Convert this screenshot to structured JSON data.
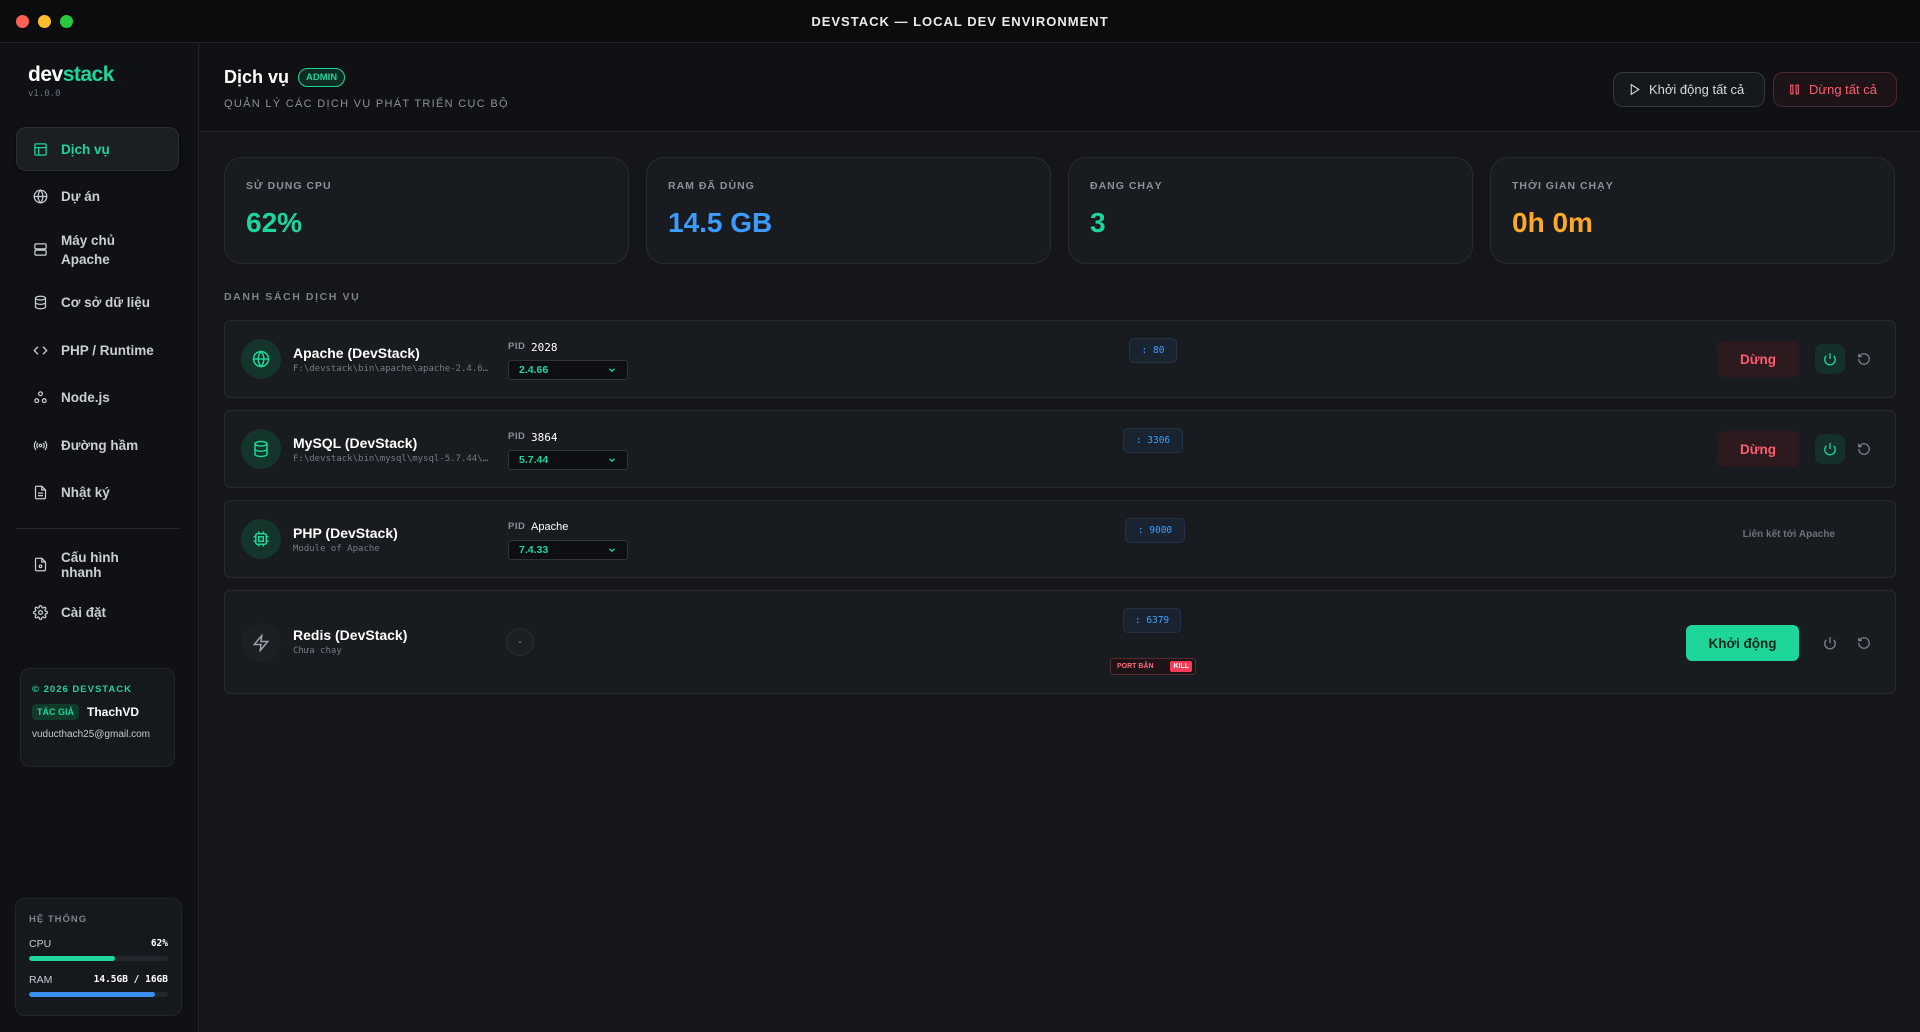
{
  "window": {
    "title": "DEVSTACK — LOCAL DEV ENVIRONMENT"
  },
  "brand": {
    "name_part1": "dev",
    "name_part2": "stack",
    "version": "v1.0.0"
  },
  "sidebar": {
    "items": [
      {
        "label": "Dịch vụ",
        "icon": "layout-icon"
      },
      {
        "label": "Dự án",
        "icon": "globe-icon"
      },
      {
        "label": "Máy chủ Apache",
        "icon": "server-icon"
      },
      {
        "label": "Cơ sở dữ liệu",
        "icon": "database-icon"
      },
      {
        "label": "PHP / Runtime",
        "icon": "code-icon"
      },
      {
        "label": "Node.js",
        "icon": "nodes-icon"
      },
      {
        "label": "Đường hầm",
        "icon": "broadcast-icon"
      },
      {
        "label": "Nhật ký",
        "icon": "file-text-icon"
      }
    ],
    "extra_items": [
      {
        "label": "Cấu hình nhanh",
        "icon": "file-config-icon"
      },
      {
        "label": "Cài đặt",
        "icon": "gear-icon"
      }
    ],
    "credit": {
      "copyright": "© 2026 DEVSTACK",
      "tag": "TÁC GIẢ",
      "author": "ThachVD",
      "email": "vuducthach25@gmail.com"
    },
    "system": {
      "heading": "HỆ THỐNG",
      "cpu_label": "CPU",
      "cpu_value": "62%",
      "cpu_fraction": 0.62,
      "ram_label": "RAM",
      "ram_value": "14.5GB / 16GB",
      "ram_fraction": 0.906
    }
  },
  "header": {
    "title": "Dịch vụ",
    "badge": "ADMIN",
    "subtitle": "QUẢN LÝ CÁC DỊCH VỤ PHÁT TRIỂN CỤC BỘ",
    "start_all": "Khởi động tất cả",
    "stop_all": "Dừng tất cả"
  },
  "stats": [
    {
      "label": "SỬ DỤNG CPU",
      "value": "62%",
      "color": "#1ed59a"
    },
    {
      "label": "RAM ĐÃ DÙNG",
      "value": "14.5 GB",
      "color": "#3b9bff"
    },
    {
      "label": "ĐANG CHẠY",
      "value": "3",
      "color": "#1ed59a"
    },
    {
      "label": "THỜI GIAN CHẠY",
      "value": "0h 0m",
      "color": "#ffa726"
    }
  ],
  "services_heading": "DANH SÁCH DỊCH VỤ",
  "services": [
    {
      "name": "Apache (DevStack)",
      "path": "F:\\devstack\\bin\\apache\\apache-2.4.6…",
      "pid_label": "PID",
      "pid": "2028",
      "version": "2.4.66",
      "port": ": 80",
      "stop": "Dừng",
      "status": "running"
    },
    {
      "name": "MySQL (DevStack)",
      "path": "F:\\devstack\\bin\\mysql\\mysql-5.7.44\\…",
      "pid_label": "PID",
      "pid": "3864",
      "version": "5.7.44",
      "port": ": 3306",
      "stop": "Dừng",
      "status": "running"
    },
    {
      "name": "PHP (DevStack)",
      "path": "Module of Apache",
      "pid_label": "PID",
      "pid": "Apache",
      "version": "7.4.33",
      "port": ": 9000",
      "linked": "Liên kết tới Apache",
      "status": "linked"
    },
    {
      "name": "Redis (DevStack)",
      "path": "Chưa chạy",
      "pid": "-",
      "port": ": 6379",
      "port_busy": "PORT BẬN",
      "kill": "KILL",
      "start": "Khởi động",
      "status": "stopped"
    }
  ]
}
